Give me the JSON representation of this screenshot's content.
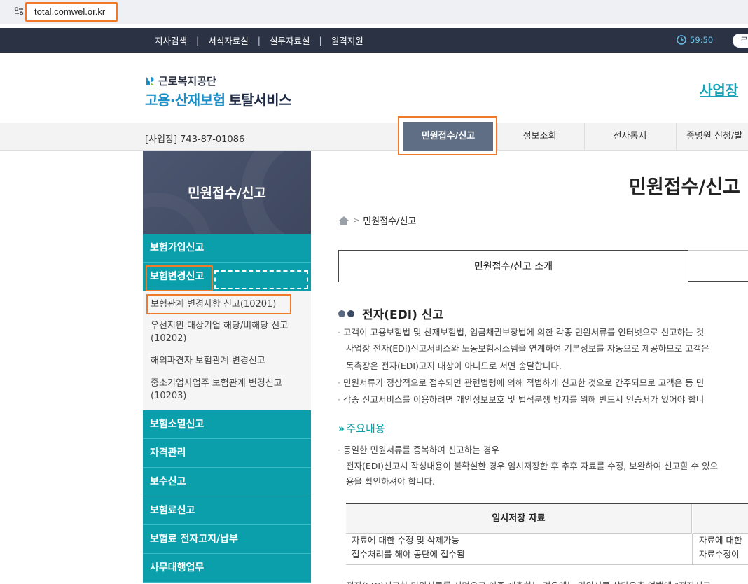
{
  "browser": {
    "url": "total.comwel.or.kr",
    "site_icon": "site-info-icon"
  },
  "topbar": {
    "links": [
      "지사검색",
      "서식자료실",
      "실무자료실",
      "원격지원"
    ],
    "separator": "|",
    "timer": "59:50",
    "login_label": "로"
  },
  "header": {
    "org_name": "근로복지공단",
    "service_name_a": "고용·산재보험",
    "service_name_b": "토탈서비스",
    "biz_link": "사업장"
  },
  "navbar": {
    "biz_no": "[사업장] 743-87-01086",
    "items": [
      "민원접수/신고",
      "정보조회",
      "전자통지",
      "증명원 신청/발"
    ]
  },
  "sidebar": {
    "title": "민원접수/신고",
    "menu": [
      {
        "label": "보험가입신고"
      },
      {
        "label": "보험변경신고"
      },
      {
        "label": "보험소멸신고"
      },
      {
        "label": "자격관리"
      },
      {
        "label": "보수신고"
      },
      {
        "label": "보험료신고"
      },
      {
        "label": "보험료 전자고지/납부"
      },
      {
        "label": "사무대행업무"
      }
    ],
    "subitems": [
      "보험관계 변경사항 신고(10201)",
      "우선지원 대상기업 해당/비해당 신고",
      "(10202)",
      "해외파견자 보험관계 변경신고",
      "중소기업사업주 보험관계 변경신고",
      "(10203)"
    ]
  },
  "main": {
    "title": "민원접수/신고",
    "breadcrumb": {
      "current": "민원접수/신고",
      "arrow": ">"
    },
    "tab_active": "민원접수/신고 소개",
    "section_title": "전자(EDI) 신고",
    "paragraphs": [
      "고객이 고용보험법 및 산재보험법, 임금채권보장법에 의한 각종 민원서류를 인터넷으로 신고하는 것",
      "사업장 전자(EDI)신고서비스와 노동보험시스템을 연계하여 기본정보를 자동으로 제공하므로 고객은",
      "독촉장은 전자(EDI)고지 대상이 아니므로 서면 송달합니다.",
      "민원서류가 정상적으로 접수되면 관련법령에 의해 적법하게 신고한 것으로 간주되므로 고객은 등 민",
      "각종 신고서비스를 이용하려면 개인정보보호 및 법적분쟁 방지를 위해 반드시 인증서가 있어야 합니"
    ],
    "sub_title": "주요내용",
    "sub_paragraphs": [
      "동일한 민원서류를 중복하여 신고하는 경우",
      "전자(EDI)신고시 작성내용이 불확실한 경우 임시저장한 후 추후 자료를 수정, 보완하여 신고할 수 있으",
      "용을 확인하셔야 합니다."
    ],
    "table": {
      "headers": [
        "임시저장 자료",
        ""
      ],
      "rows": [
        [
          "자료에 대한 수정 및 삭제가능",
          "자료에 대한"
        ],
        [
          "접수처리를 해야 공단에 접수됨",
          "자료수정이"
        ]
      ]
    },
    "footer_cut": "전자(EDI)신고한 민원서류를 서면으로 이중 제출하는 경우에는 민원서류 상단우측 여백에 \"전자신고"
  },
  "colors": {
    "accent_teal": "#0a9faa",
    "navy": "#2a3244",
    "highlight": "#f07a2a"
  }
}
